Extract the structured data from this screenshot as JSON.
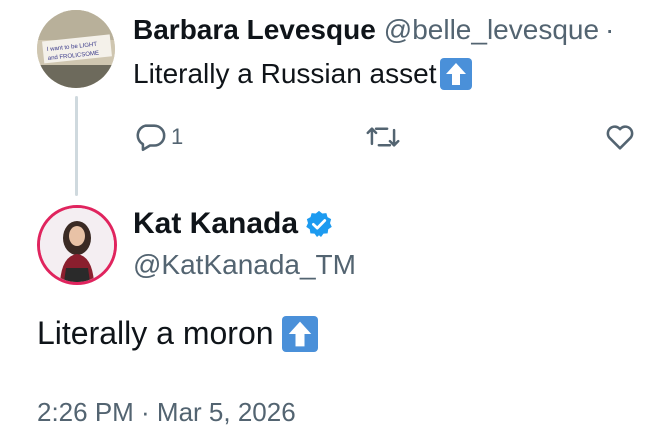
{
  "reply_tweet": {
    "display_name": "Barbara Levesque",
    "handle": "@belle_levesque",
    "separator": "·",
    "text": "Literally a Russian asset",
    "emoji": "up-arrow-button",
    "avatar_sign_text": [
      "I want to be LIGHT",
      "and FROLICSOME"
    ],
    "actions": {
      "reply_count": "1",
      "retweet_count": "",
      "like_count": ""
    }
  },
  "main_tweet": {
    "display_name": "Kat Kanada",
    "handle": "@KatKanada_TM",
    "verified": true,
    "text": "Literally a moron",
    "emoji": "up-arrow-button",
    "timestamp": "2:26 PM · Mar 5, 2026"
  },
  "colors": {
    "text_primary": "#0f1419",
    "text_secondary": "#536471",
    "verified_blue": "#1d9bf0",
    "emoji_blue": "#4a90d9",
    "thread_line": "#cfd9de",
    "avatar_ring": "#e0245e"
  }
}
